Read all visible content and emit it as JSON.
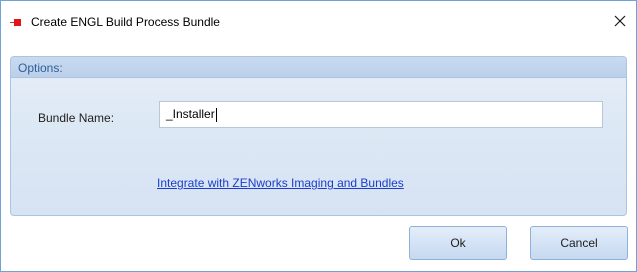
{
  "window": {
    "title": "Create ENGL Build Process Bundle",
    "close_label": "×"
  },
  "options_group": {
    "header": "Options:",
    "bundle_name_label": "Bundle Name:",
    "bundle_name_value": "_Installer",
    "integrate_link": "Integrate with ZENworks Imaging and Bundles"
  },
  "buttons": {
    "ok": "Ok",
    "cancel": "Cancel"
  },
  "icons": {
    "app": "build-bundle-icon",
    "close": "close-icon"
  },
  "colors": {
    "accent": "#e3141b",
    "link": "#1a3ecc",
    "group_header_text": "#2d5e9a"
  }
}
